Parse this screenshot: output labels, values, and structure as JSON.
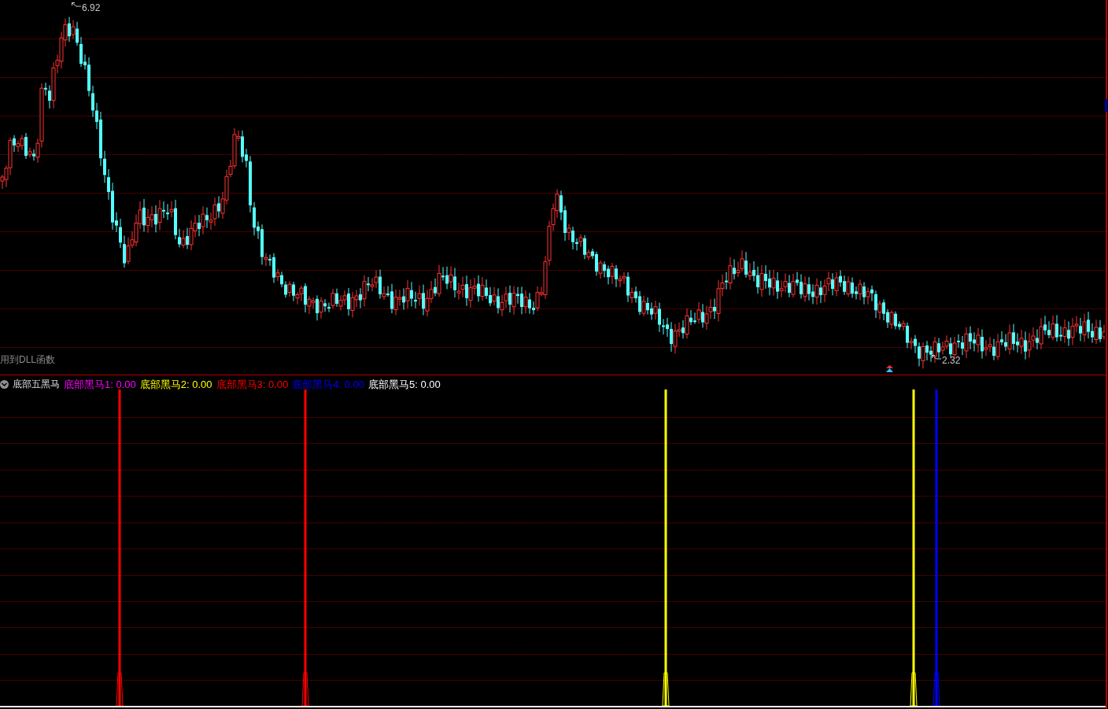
{
  "price_panel": {
    "high_label": "6.92",
    "low_label": "2.32",
    "note": "用到DLL函数"
  },
  "indicator_panel": {
    "title": "底部五黑马",
    "legend": [
      {
        "text": "底部黑马1: 0.00",
        "color": "#ff00ff"
      },
      {
        "text": "底部黑马2: 0.00",
        "color": "#ffff00"
      },
      {
        "text": "底部黑马3: 0.00",
        "color": "#ff0000"
      },
      {
        "text": "底部黑马4: 0.00",
        "color": "#0000ff"
      },
      {
        "text": "底部黑马5: 0.00",
        "color": "#ffffff"
      }
    ]
  }
}
